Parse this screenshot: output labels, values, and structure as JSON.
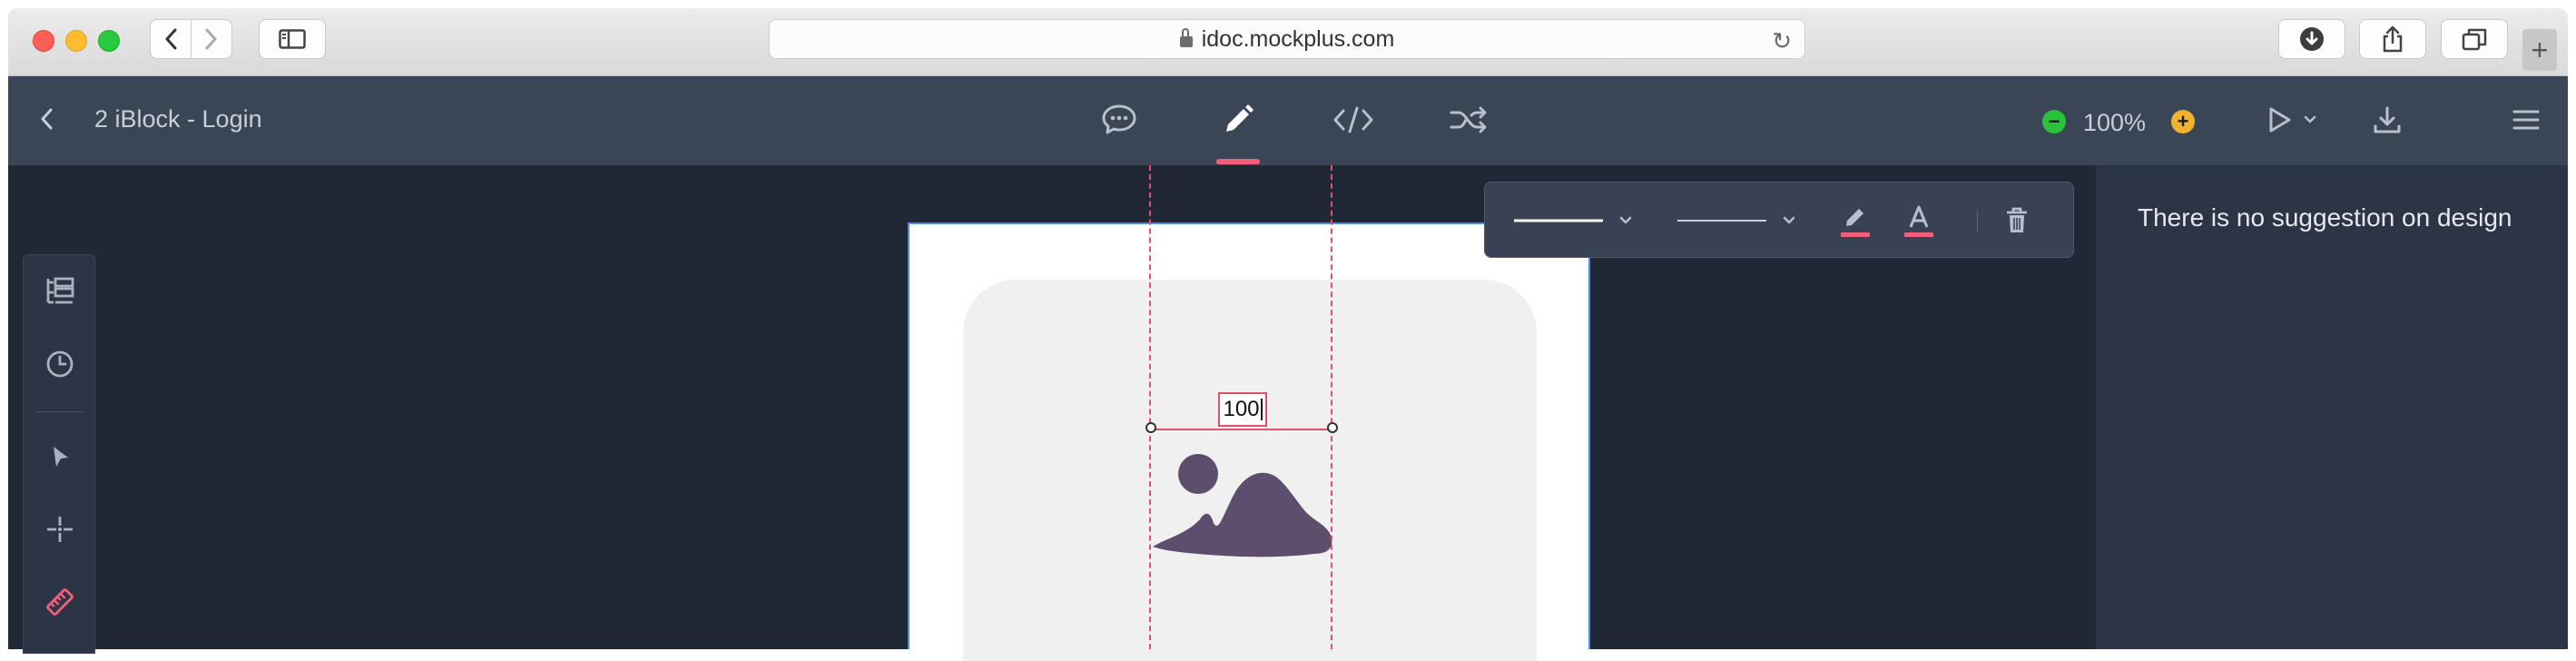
{
  "browser": {
    "url": "idoc.mockplus.com",
    "new_tab_label": "+"
  },
  "app": {
    "back_label": "‹",
    "page_title": "2 iBlock - Login",
    "tabs": [
      {
        "name": "comment",
        "icon": "chat-bubble-icon",
        "active": false
      },
      {
        "name": "design",
        "icon": "pencil-icon",
        "active": true
      },
      {
        "name": "code",
        "icon": "code-icon",
        "active": false
      },
      {
        "name": "flow",
        "icon": "shuffle-icon",
        "active": false
      }
    ],
    "zoom": {
      "value": "100%",
      "minus": "−",
      "plus": "+"
    },
    "accent_color": "#f25f7a"
  },
  "left_tools": [
    {
      "name": "layers",
      "icon": "layers-icon"
    },
    {
      "name": "history",
      "icon": "clock-icon"
    },
    {
      "name": "select",
      "icon": "cursor-icon"
    },
    {
      "name": "crosshair",
      "icon": "crosshair-icon"
    },
    {
      "name": "measure",
      "icon": "ruler-icon"
    }
  ],
  "canvas": {
    "measurement_value": "100"
  },
  "right_panel": {
    "message": "There is no suggestion on design"
  },
  "colors": {
    "appbar": "#3a4556",
    "workspace": "#202836",
    "panel": "#2c3546",
    "measure_line": "#e0506a",
    "image_icon": "#5d4e6d"
  }
}
